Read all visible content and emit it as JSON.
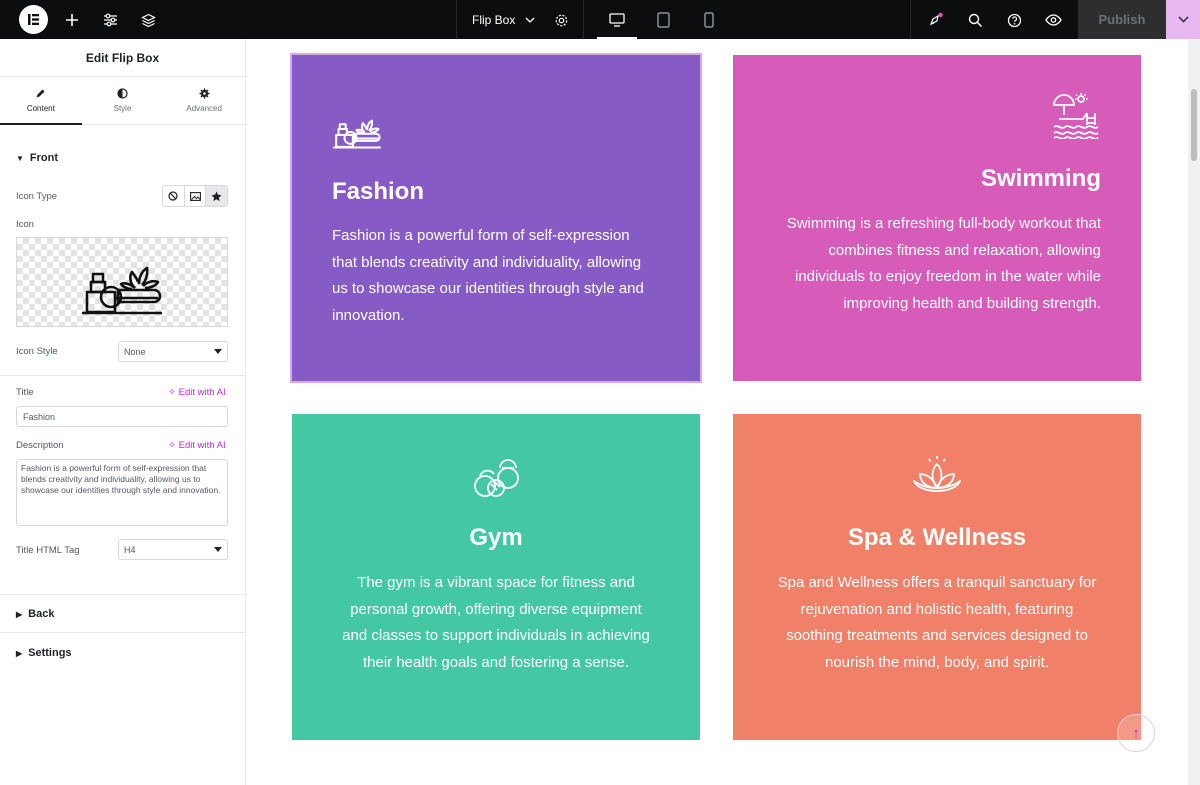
{
  "topbar": {
    "document_title": "Flip Box",
    "publish_label": "Publish",
    "icons": [
      "elementor-logo-icon",
      "add-icon",
      "settings-sliders-icon",
      "layers-icon",
      "chevron-down-icon",
      "gear-icon",
      "desktop-icon",
      "tablet-icon",
      "mobile-icon",
      "notifications-icon",
      "search-icon",
      "help-icon",
      "preview-eye-icon"
    ]
  },
  "panel": {
    "title": "Edit Flip Box",
    "tabs": [
      {
        "label": "Content",
        "icon": "pencil-icon"
      },
      {
        "label": "Style",
        "icon": "contrast-icon"
      },
      {
        "label": "Advanced",
        "icon": "gear-icon"
      }
    ],
    "front_section": "Front",
    "icon_type_label": "Icon Type",
    "icon_label": "Icon",
    "icon_style_label": "Icon Style",
    "icon_style_value": "None",
    "title_label": "Title",
    "title_value": "Fashion",
    "edit_ai_label": "Edit with AI",
    "description_label": "Description",
    "description_value": "Fashion is a powerful form of self-expression that blends creativity and individuality, allowing us to showcase our identities through style and innovation.",
    "title_tag_label": "Title HTML Tag",
    "title_tag_value": "H4",
    "back_section": "Back",
    "settings_section": "Settings"
  },
  "cards": [
    {
      "title": "Fashion",
      "icon": "cosmetics-icon",
      "color": "#875bc6",
      "text": "Fashion is a powerful form of self-expression that blends creativity and individuality, allowing us to showcase our identities through style and innovation."
    },
    {
      "title": "Swimming",
      "icon": "swimming-pool-icon",
      "color": "#d75cb9",
      "text": "Swimming is a refreshing full-body workout that combines fitness and relaxation, allowing individuals to enjoy freedom in the water while improving health and building strength."
    },
    {
      "title": "Gym",
      "icon": "kettlebell-icon",
      "color": "#44c8a4",
      "text": "The gym is a vibrant space for fitness and personal growth, offering diverse equipment and classes to support individuals in achieving their health goals and fostering a sense."
    },
    {
      "title": "Spa & Wellness",
      "icon": "lotus-icon",
      "color": "#f08068",
      "text": "Spa and Wellness offers a tranquil sanctuary for rejuvenation and holistic health, featuring soothing treatments and services designed to nourish the mind, body, and spirit."
    }
  ],
  "colors": {
    "accent": "#c32ad8",
    "topbar": "#0c0d0e"
  }
}
